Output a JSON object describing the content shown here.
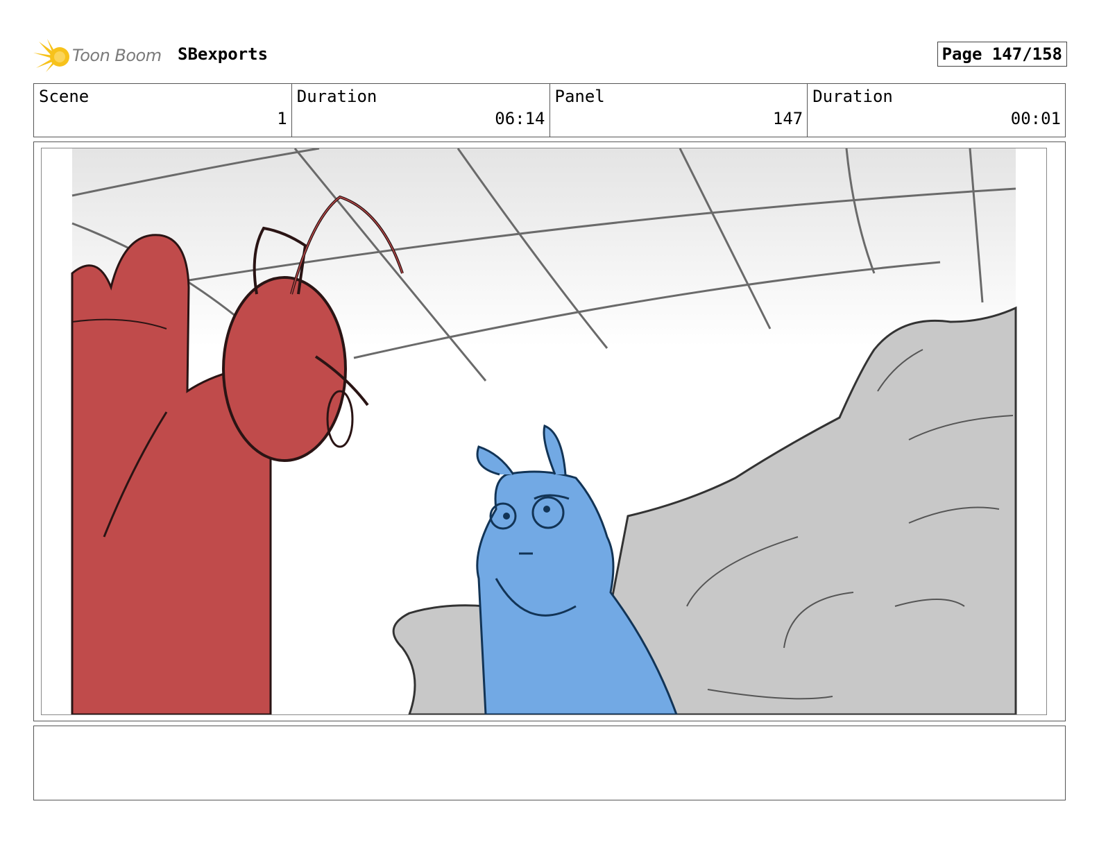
{
  "header": {
    "logo_text": "Toon Boom",
    "project_title": "SBexports",
    "page_label": "Page 147/158"
  },
  "info": {
    "scene_label": "Scene",
    "scene_value": "1",
    "scene_duration_label": "Duration",
    "scene_duration_value": "06:14",
    "panel_label": "Panel",
    "panel_value": "147",
    "panel_duration_label": "Duration",
    "panel_duration_value": "00:01"
  },
  "panel": {
    "description": ""
  },
  "colors": {
    "red_character": "#c04b4b",
    "blue_character": "#72a9e4",
    "rocks": "#c8c8c8",
    "logo_yellow": "#f7c21b"
  }
}
